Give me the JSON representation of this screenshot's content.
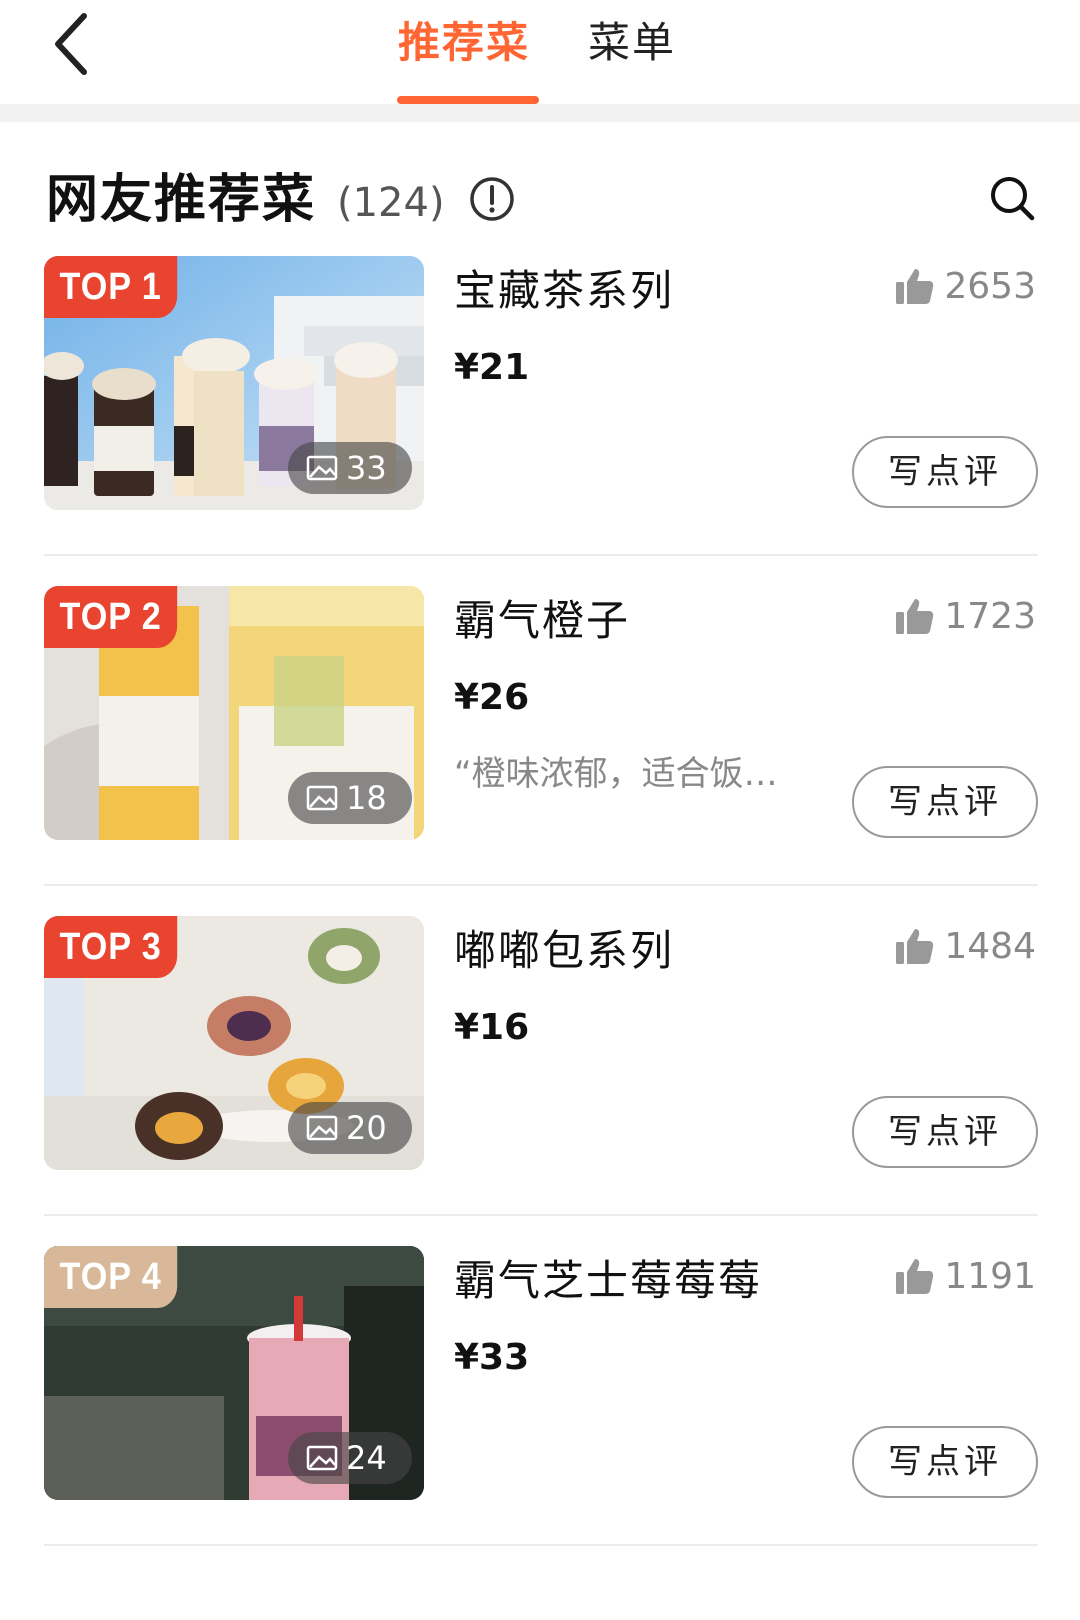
{
  "tabs": [
    {
      "label": "推荐菜",
      "active": true
    },
    {
      "label": "菜单",
      "active": false
    }
  ],
  "section": {
    "title": "网友推荐菜",
    "count": "(124)"
  },
  "colors": {
    "accent": "#ff6633",
    "rank_red": "#e8442f",
    "rank_tan": "#d9b89a"
  },
  "icons": {
    "back": "chevron-left-icon",
    "info": "exclamation-circle-icon",
    "search": "search-icon",
    "photo": "image-icon",
    "like": "thumbs-up-icon"
  },
  "items": [
    {
      "rank": "TOP 1",
      "name": "宝藏茶系列",
      "price": "¥21",
      "quote": "",
      "likes": "2653",
      "photos": "33",
      "review_label": "写点评"
    },
    {
      "rank": "TOP 2",
      "name": "霸气橙子",
      "price": "¥26",
      "quote": "“橙味浓郁，适合饭…",
      "likes": "1723",
      "photos": "18",
      "review_label": "写点评"
    },
    {
      "rank": "TOP 3",
      "name": "嘟嘟包系列",
      "price": "¥16",
      "quote": "",
      "likes": "1484",
      "photos": "20",
      "review_label": "写点评"
    },
    {
      "rank": "TOP 4",
      "name": "霸气芝士莓莓莓",
      "price": "¥33",
      "quote": "",
      "likes": "1191",
      "photos": "24",
      "review_label": "写点评"
    }
  ]
}
